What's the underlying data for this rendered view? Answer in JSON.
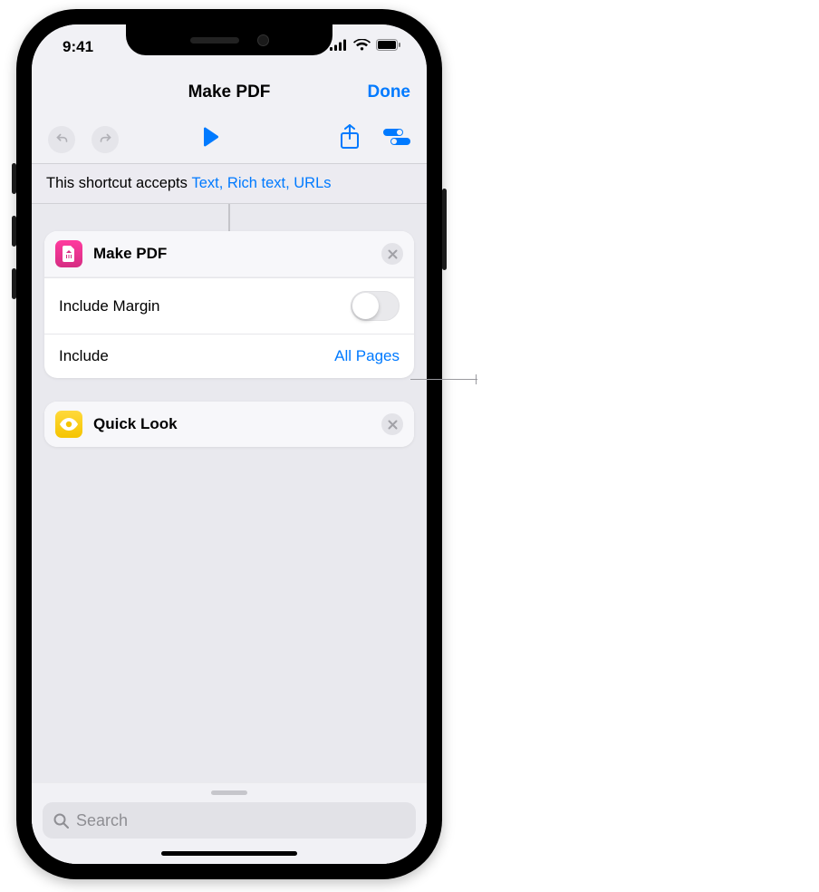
{
  "status": {
    "time": "9:41"
  },
  "nav": {
    "title": "Make PDF",
    "done_label": "Done"
  },
  "banner": {
    "prefix": "This shortcut accepts ",
    "types": "Text, Rich text, URLs"
  },
  "actions": {
    "make_pdf": {
      "title": "Make PDF",
      "rows": {
        "include_margin": {
          "label": "Include Margin",
          "enabled": false
        },
        "include": {
          "label": "Include",
          "value": "All Pages"
        }
      }
    },
    "quick_look": {
      "title": "Quick Look"
    }
  },
  "search": {
    "placeholder": "Search"
  },
  "icons": {
    "undo": "undo-icon",
    "redo": "redo-icon",
    "play": "play-icon",
    "share": "share-icon",
    "settings_toggle": "toggles-icon",
    "close": "close-icon",
    "pdf": "pdf-doc-icon",
    "eye": "eye-icon",
    "search": "search-icon",
    "signal": "cell-signal-icon",
    "wifi": "wifi-icon",
    "battery": "battery-icon"
  }
}
